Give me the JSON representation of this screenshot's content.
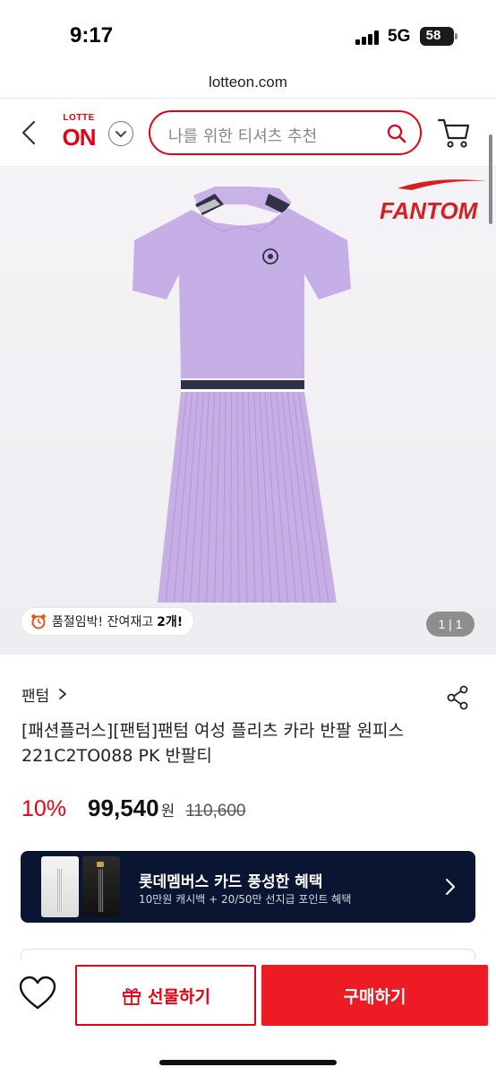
{
  "status_bar": {
    "time": "9:17",
    "network": "5G",
    "battery": "58",
    "battery_level": 0.58
  },
  "browser": {
    "url": "lotteon.com"
  },
  "header": {
    "logo_top": "LOTTE",
    "logo_main": "ON",
    "search_placeholder": "나를 위한 티셔츠 추천"
  },
  "product_image": {
    "stock_alert": "품절임박! 잔여재고",
    "stock_count": "2개!",
    "image_counter": "1 | 1",
    "accent_color": "#c9aee6"
  },
  "product": {
    "brand": "팬텀",
    "title_line1": "[패션플러스][팬텀]팬텀 여성 플리츠 카라 반팔 원피스",
    "title_line2": "221C2TO088 PK 반팔티",
    "discount": "10%",
    "sale_price": "99,540",
    "currency": "원",
    "original_price": "110,600"
  },
  "card_banner": {
    "title": "롯데멤버스 카드 풍성한 혜택",
    "subtitle": "10만원 캐시백 + 20/50만 선지급 포인트 혜택"
  },
  "bottom_bar": {
    "gift_label": "선물하기",
    "buy_label": "구매하기"
  },
  "colors": {
    "brand_red": "#e60012",
    "banner_navy": "#0a1532"
  }
}
